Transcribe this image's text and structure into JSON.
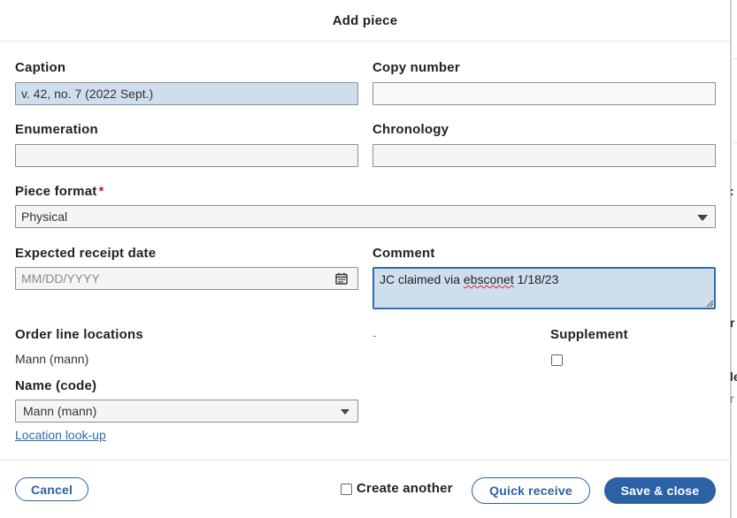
{
  "modal": {
    "title": "Add piece"
  },
  "form": {
    "caption": {
      "label": "Caption",
      "value": "v. 42, no. 7 (2022 Sept.)"
    },
    "copy_number": {
      "label": "Copy number",
      "value": ""
    },
    "enumeration": {
      "label": "Enumeration",
      "value": ""
    },
    "chronology": {
      "label": "Chronology",
      "value": ""
    },
    "piece_format": {
      "label": "Piece format",
      "required_mark": "*",
      "value": "Physical"
    },
    "expected_receipt_date": {
      "label": "Expected receipt date",
      "placeholder": "MM/DD/YYYY"
    },
    "comment": {
      "label": "Comment",
      "value_prefix": "JC claimed via ",
      "value_misspelled": "ebsconet",
      "value_suffix": " 1/18/23"
    },
    "order_line_locations": {
      "label": "Order line locations",
      "value": "Mann (mann)"
    },
    "dash": "-",
    "supplement": {
      "label": "Supplement",
      "checked": false
    },
    "name_code": {
      "label": "Name (code)",
      "value": "Mann (mann)"
    },
    "location_lookup": "Location look-up"
  },
  "footer": {
    "cancel": "Cancel",
    "create_another": "Create another",
    "quick_receive": "Quick receive",
    "save_close": "Save & close"
  },
  "background": {
    "glyph_colon": ":",
    "glyph_r": "r",
    "glyph_le": "le",
    "glyph_r2": "r"
  },
  "colors": {
    "primary": "#2b62a6",
    "filled_input": "#cfdeed",
    "required": "#c41e1e"
  }
}
